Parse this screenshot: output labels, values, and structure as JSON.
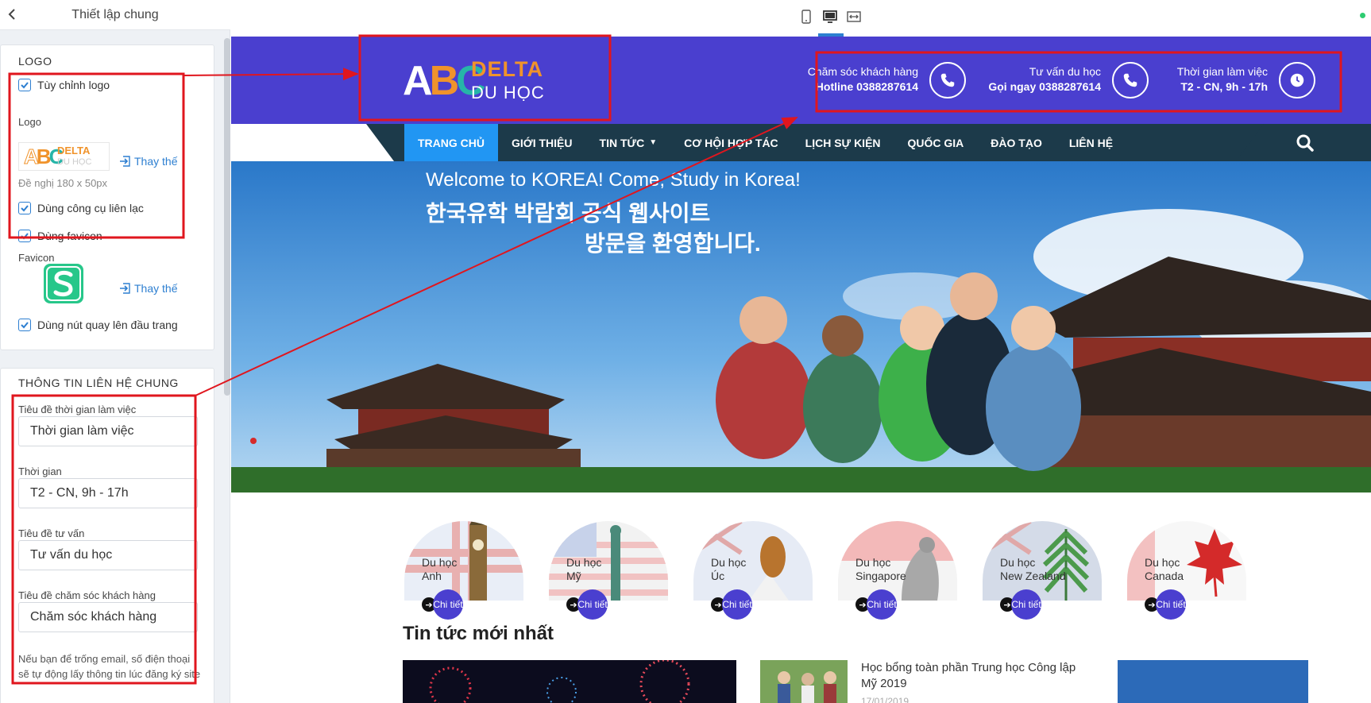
{
  "panel": {
    "title": "Thiết lập chung",
    "logo_section": {
      "title": "LOGO",
      "custom_logo_label": "Tùy chỉnh logo",
      "logo_label": "Logo",
      "replace_label": "Thay thế",
      "hint": "Đề nghị 180 x 50px",
      "contact_tool_label": "Dùng công cụ liên lạc",
      "favicon_toggle_label": "Dùng favicon",
      "favicon_label": "Favicon",
      "replace_label_2": "Thay thế",
      "back_to_top_label": "Dùng nút quay lên đầu trang"
    },
    "contact_section": {
      "title": "THÔNG TIN LIÊN HỆ CHUNG",
      "work_time_title_label": "Tiêu đề thời gian làm việc",
      "work_time_title_value": "Thời gian làm việc",
      "time_label": "Thời gian",
      "time_value": "T2 - CN, 9h - 17h",
      "consult_title_label": "Tiêu đề tư vấn",
      "consult_title_value": "Tư vấn du học",
      "care_title_label": "Tiêu đề chăm sóc khách hàng",
      "care_title_value": "Chăm sóc khách hàng",
      "note": "Nếu bạn để trống email, số điện thoại sẽ tự động lấy thông tin lúc đăng ký site"
    }
  },
  "toolbar": {
    "devices": [
      "mobile-icon",
      "desktop-icon",
      "fullwidth-icon"
    ],
    "active_device": "desktop"
  },
  "site": {
    "logo": {
      "abc": [
        "A",
        "B",
        "C"
      ],
      "delta": "DELTA",
      "subtitle": "DU HỌC"
    },
    "header_items": [
      {
        "line1": "Chăm sóc khách hàng",
        "line2": "Hotline 0388287614",
        "icon": "phone-icon"
      },
      {
        "line1": "Tư vấn du học",
        "line2": "Gọi ngay 0388287614",
        "icon": "phone-icon"
      },
      {
        "line1": "Thời gian làm việc",
        "line2": "T2 - CN, 9h - 17h",
        "icon": "clock-icon"
      }
    ],
    "nav": [
      "TRANG CHỦ",
      "GIỚI THIỆU",
      "TIN TỨC",
      "CƠ HỘI HỢP TÁC",
      "LỊCH SỰ KIỆN",
      "QUỐC GIA",
      "ĐÀO TẠO",
      "LIÊN HỆ"
    ],
    "banner": {
      "line_en": "Welcome to KOREA! Come, Study in Korea!",
      "line_ko1": "한국유학 박람회 공식 웹사이트",
      "line_ko2": "방문을 환영합니다."
    },
    "destinations": [
      {
        "line1": "Du học",
        "line2": "Anh"
      },
      {
        "line1": "Du học",
        "line2": "Mỹ"
      },
      {
        "line1": "Du học",
        "line2": "Úc"
      },
      {
        "line1": "Du học",
        "line2": "Singapore"
      },
      {
        "line1": "Du học",
        "line2": "New Zealand"
      },
      {
        "line1": "Du học",
        "line2": "Canada"
      }
    ],
    "detail_label": "Chi tiết",
    "news": {
      "heading": "Tin tức mới nhất",
      "item2_title": "Học bổng toàn phần Trung học Công lập Mỹ 2019",
      "item2_date": "17/01/2019"
    }
  },
  "colors": {
    "brand_purple": "#4a3fcf",
    "nav_dark": "#1c3a4a",
    "nav_active": "#2196f3",
    "accent_orange": "#f0932b",
    "accent_teal": "#26b5a8",
    "link_blue": "#2d7fd1",
    "annotation_red": "#e0161e"
  }
}
